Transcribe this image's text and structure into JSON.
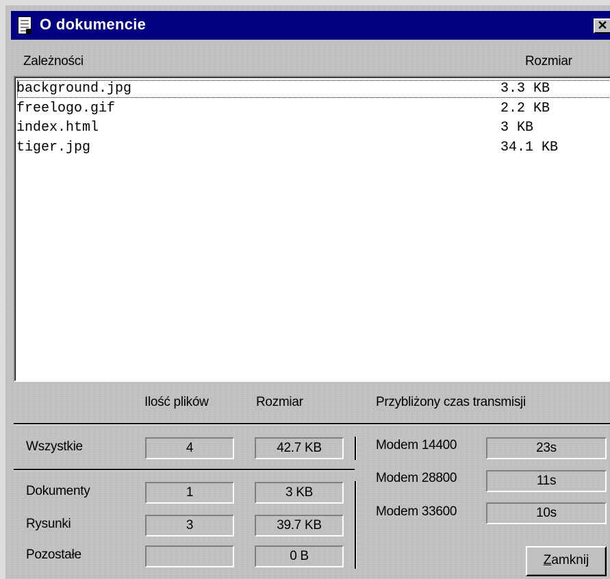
{
  "window": {
    "title": "O dokumencie",
    "doc_icon": "document-icon",
    "close_glyph": "✕"
  },
  "list": {
    "headers": {
      "name": "Zależności",
      "size": "Rozmiar"
    },
    "rows": [
      {
        "name": "background.jpg",
        "size": "3.3 KB",
        "selected": true
      },
      {
        "name": "freelogo.gif",
        "size": "2.2 KB"
      },
      {
        "name": "index.html",
        "size": "3 KB"
      },
      {
        "name": "tiger.jpg",
        "size": "34.1 KB"
      }
    ]
  },
  "stats": {
    "headers": {
      "count": "Ilość plików",
      "size": "Rozmiar",
      "transfer": "Przybliżony czas transmisji"
    },
    "all": {
      "label": "Wszystkie",
      "count": "4",
      "size": "42.7 KB"
    },
    "documents": {
      "label": "Dokumenty",
      "count": "1",
      "size": "3 KB"
    },
    "images": {
      "label": "Rysunki",
      "count": "3",
      "size": "39.7 KB"
    },
    "other": {
      "label": "Pozostałe",
      "count": "",
      "size": "0 B"
    }
  },
  "transfer": [
    {
      "label": "Modem 14400",
      "time": "23s"
    },
    {
      "label": "Modem 28800",
      "time": "11s"
    },
    {
      "label": "Modem 33600",
      "time": "10s"
    }
  ],
  "close_button": {
    "first": "Z",
    "rest": "amknij"
  }
}
